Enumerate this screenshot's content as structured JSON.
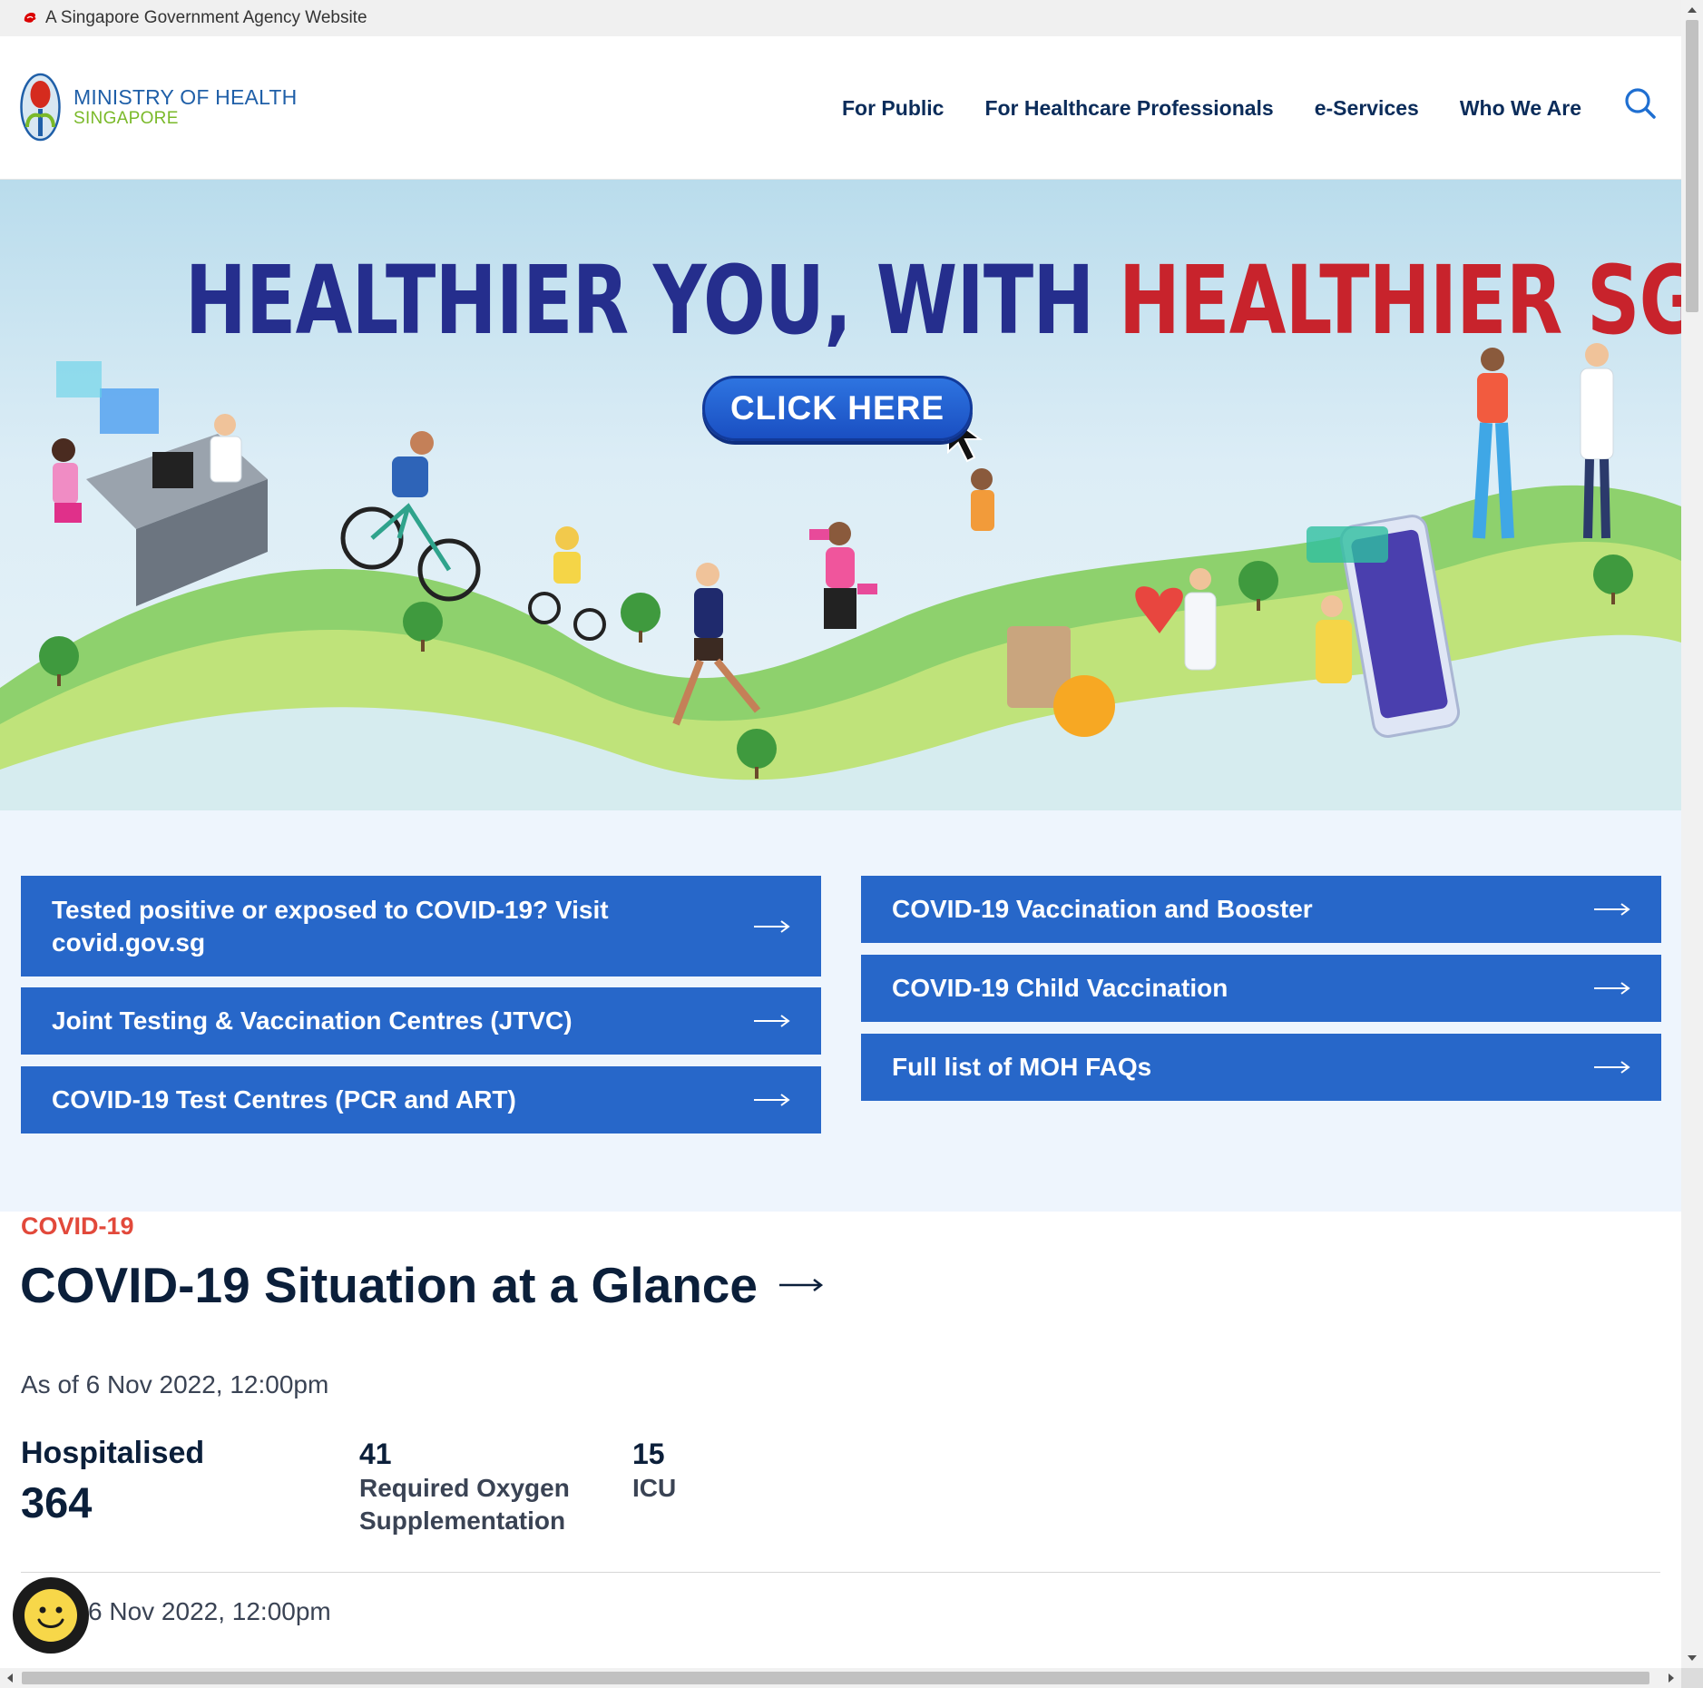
{
  "masthead": {
    "text": "A Singapore Government Agency Website",
    "icon": "lion-head-icon"
  },
  "header": {
    "logo_line1": "MINISTRY OF HEALTH",
    "logo_line2": "SINGAPORE",
    "nav": [
      {
        "label": "For Public"
      },
      {
        "label": "For Healthcare Professionals"
      },
      {
        "label": "e-Services"
      },
      {
        "label": "Who We Are"
      }
    ],
    "search_icon": "search-icon"
  },
  "hero": {
    "title_part1": "HEALTHIER YOU, WITH ",
    "title_part2": "HEALTHIER SG",
    "cta": "CLICK HERE"
  },
  "quick_links": {
    "left": [
      {
        "label": "Tested positive or exposed to COVID-19? Visit covid.gov.sg"
      },
      {
        "label": "Joint Testing & Vaccination Centres (JTVC)"
      },
      {
        "label": "COVID-19 Test Centres (PCR and ART)"
      }
    ],
    "right": [
      {
        "label": "COVID-19 Vaccination and Booster"
      },
      {
        "label": "COVID-19 Child Vaccination"
      },
      {
        "label": "Full list of MOH FAQs"
      }
    ],
    "arrow_icon": "arrow-right-icon"
  },
  "covid": {
    "eyebrow": "COVID-19",
    "title": "COVID-19 Situation at a Glance",
    "as_of": "As of 6 Nov 2022, 12:00pm",
    "hospitalised_label": "Hospitalised",
    "hospitalised_value": "364",
    "oxygen_value": "41",
    "oxygen_label_1": "Required Oxygen",
    "oxygen_label_2": "Supplementation",
    "icu_value": "15",
    "icu_label": "ICU",
    "as_of_2": "6 Nov 2022, 12:00pm"
  },
  "colors": {
    "brand_blue": "#2767c9",
    "navy": "#0b1f3a",
    "eyebrow_red": "#e2493b",
    "hero_blue": "#252e8d",
    "hero_red": "#c8232c",
    "quick_bg": "#eef5fd"
  },
  "feedback_icon": "smiley-face-icon"
}
